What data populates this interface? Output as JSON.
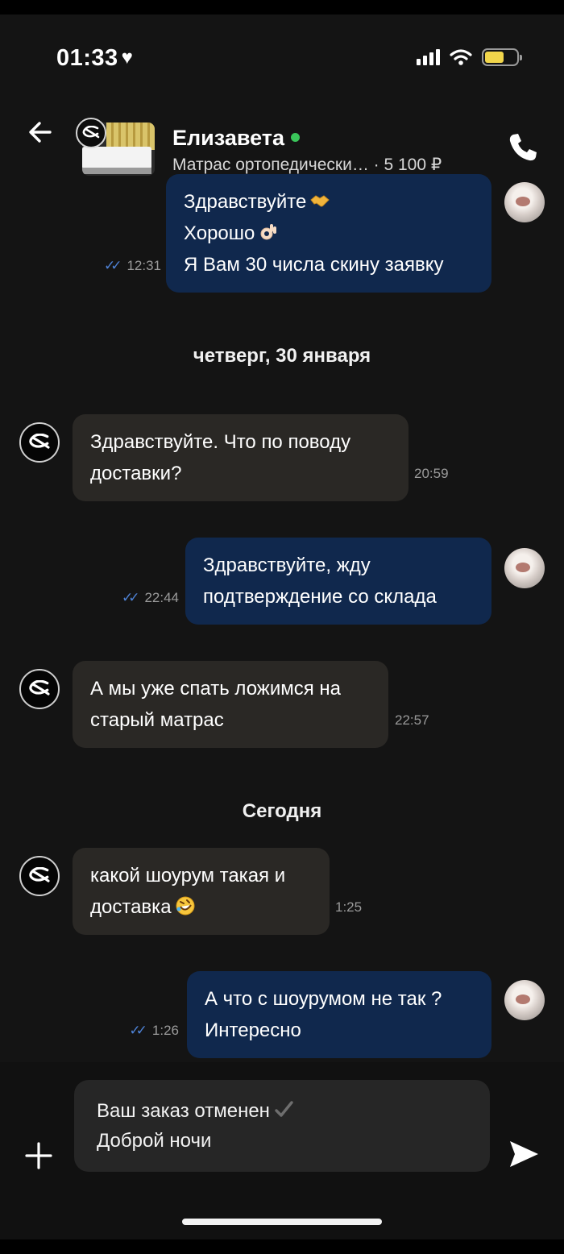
{
  "status_bar": {
    "time": "01:33",
    "heart": "♥"
  },
  "header": {
    "name": "Елизавета",
    "subtitle": "Матрас ортопедически… · 5 100 ₽",
    "online_color": "#3ac55a"
  },
  "messages": [
    {
      "side": "out",
      "lines": [
        "Здравствуйте",
        "Хорошо",
        "Я Вам 30 числа скину заявку"
      ],
      "time": "12:31"
    },
    {
      "side": "in",
      "lines": [
        "Здравствуйте. Что по поводу",
        "доставки?"
      ],
      "time": "20:59"
    },
    {
      "side": "out",
      "lines": [
        "Здравствуйте, жду",
        "подтверждение со склада"
      ],
      "time": "22:44"
    },
    {
      "side": "in",
      "lines": [
        "А мы уже спать ложимся на",
        "старый матрас"
      ],
      "time": "22:57"
    },
    {
      "side": "in",
      "lines": [
        "какой шоурум такая и",
        "доставка"
      ],
      "time": "1:25"
    },
    {
      "side": "out",
      "lines": [
        "А что с шоурумом  не так ?",
        "Интересно"
      ],
      "time": "1:26"
    }
  ],
  "date_separators": [
    "четверг, 30 января",
    "Сегодня"
  ],
  "composer": {
    "lines": [
      "Ваш заказ отменен",
      "Доброй ночи"
    ]
  },
  "colors": {
    "outgoing_bubble": "#10284d",
    "incoming_bubble": "#2a2825",
    "read_ticks": "#4e82d6",
    "background": "#141414"
  },
  "icons": [
    "back-arrow-icon",
    "phone-icon",
    "plus-icon",
    "send-icon",
    "handshake-emoji",
    "ok-hand-emoji",
    "rofl-emoji",
    "check-mark-emoji",
    "signal-icon",
    "wifi-icon",
    "battery-icon"
  ]
}
